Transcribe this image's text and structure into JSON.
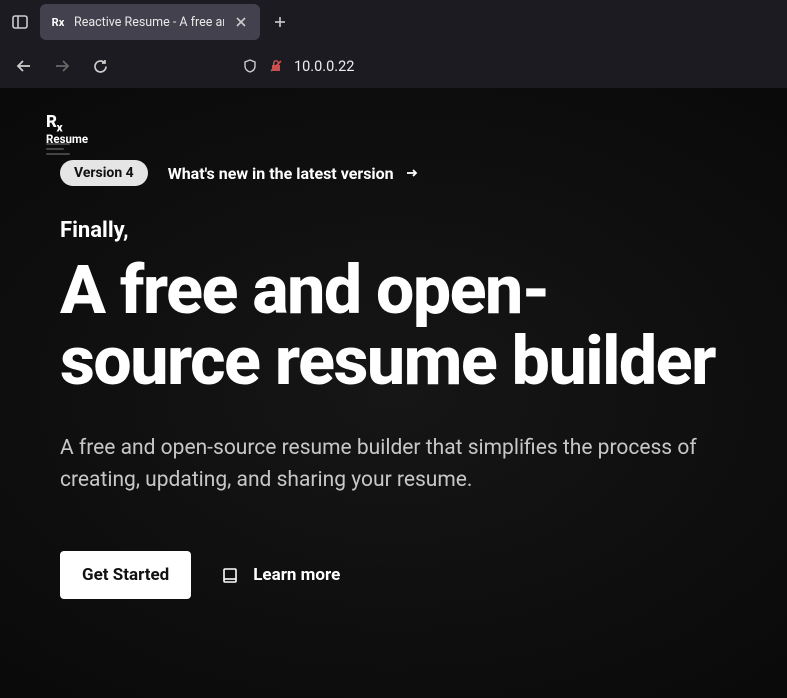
{
  "browser": {
    "tab_title": "Reactive Resume - A free and o",
    "tab_favicon": "Rx",
    "url": "10.0.0.22"
  },
  "page": {
    "logo": {
      "rx": "R",
      "x": "x",
      "resume": "Resume"
    },
    "version_badge": "Version 4",
    "whats_new": "What's new in the latest version",
    "eyebrow": "Finally,",
    "title": "A free and open-source resume builder",
    "description": "A free and open-source resume builder that simplifies the process of creating, updating, and sharing your resume.",
    "cta_primary": "Get Started",
    "cta_secondary": "Learn more"
  }
}
